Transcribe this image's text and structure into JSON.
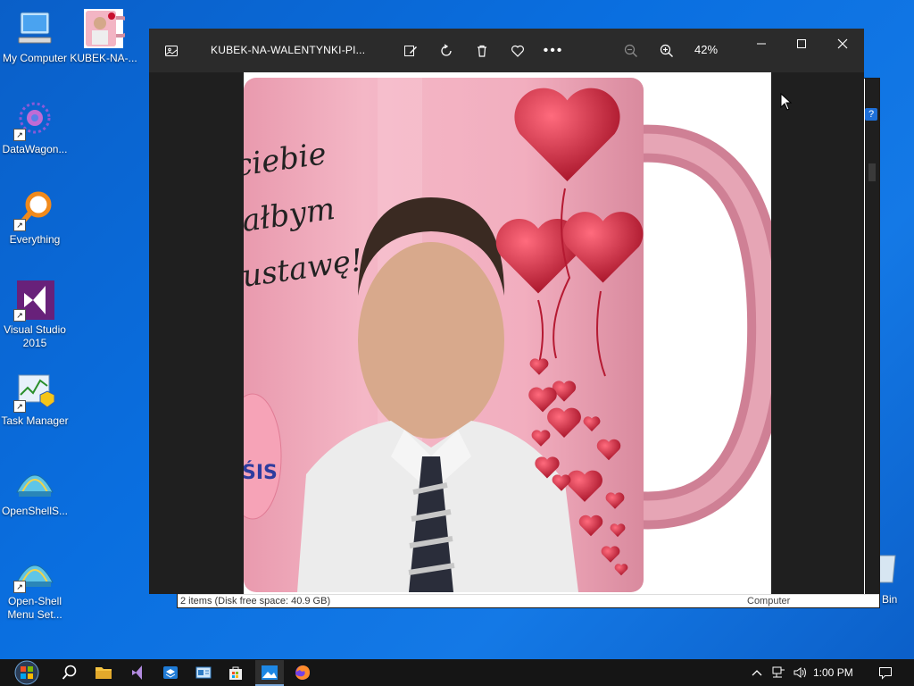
{
  "desktop": {
    "icons": [
      {
        "label": "My Computer"
      },
      {
        "label": "KUBEK-NA-..."
      },
      {
        "label": "DataWagon..."
      },
      {
        "label": "Everything"
      },
      {
        "label": "Visual Studio 2015"
      },
      {
        "label": "Task Manager"
      },
      {
        "label": "OpenShellS..."
      },
      {
        "label": "Open-Shell Menu Set..."
      }
    ],
    "recycle_label": "Bin"
  },
  "explorer": {
    "status_left": "2 items (Disk free space: 40.9 GB)",
    "status_right": "Computer"
  },
  "photos": {
    "filename": "KUBEK-NA-WALENTYNKI-PI...",
    "zoom": "42%",
    "image_text": {
      "line1": "ciebie",
      "line2": "ałbym",
      "line3": "ustawę!",
      "logo_fragment": "ŚIS"
    }
  },
  "taskbar": {
    "clock": "1:00 PM"
  },
  "colors": {
    "desktop_blue": "#0a6fe0",
    "photos_bg": "#1f1f1f",
    "mug_pink": "#f0a7b8",
    "heart_red": "#c8102e"
  }
}
